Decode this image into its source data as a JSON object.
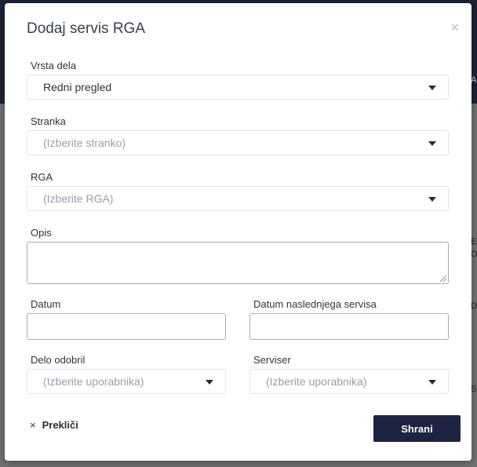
{
  "background": {
    "fragments": [
      "A",
      "E",
      "O",
      "D",
      "S"
    ]
  },
  "modal": {
    "title": "Dodaj servis RGA",
    "close_label": "×"
  },
  "form": {
    "vrsta_dela": {
      "label": "Vrsta dela",
      "value": "Redni pregled"
    },
    "stranka": {
      "label": "Stranka",
      "placeholder": "(Izberite stranko)"
    },
    "rga": {
      "label": "RGA",
      "placeholder": "(Izberite RGA)"
    },
    "opis": {
      "label": "Opis",
      "value": ""
    },
    "datum": {
      "label": "Datum",
      "value": ""
    },
    "datum_naslednjega": {
      "label": "Datum naslednjega servisa",
      "value": ""
    },
    "delo_odobril": {
      "label": "Delo odobril",
      "placeholder": "(Izberite uporabnika)"
    },
    "serviser": {
      "label": "Serviser",
      "placeholder": "(Izberite uporabnika)"
    }
  },
  "actions": {
    "cancel_icon": "×",
    "cancel_label": "Prekliči",
    "save_label": "Shrani"
  },
  "colors": {
    "primary_button": "#1d2340",
    "header_dark": "#1d2233"
  }
}
